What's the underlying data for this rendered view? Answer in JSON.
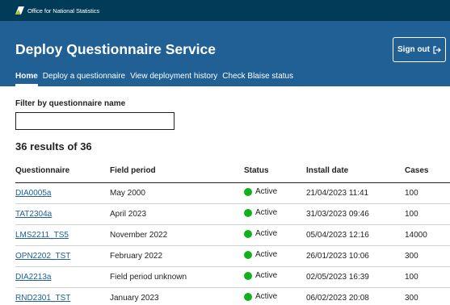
{
  "header": {
    "org_name": "Office for National Statistics",
    "org_icon": "ons-logo-icon",
    "title": "Deploy Questionnaire Service",
    "sign_out_label": "Sign out",
    "sign_out_icon": "sign-out-icon"
  },
  "nav": {
    "items": [
      {
        "label": "Home",
        "active": true
      },
      {
        "label": "Deploy a questionnaire",
        "active": false
      },
      {
        "label": "View deployment history",
        "active": false
      },
      {
        "label": "Check Blaise status",
        "active": false
      }
    ]
  },
  "filter": {
    "label": "Filter by questionnaire name",
    "value": ""
  },
  "results_summary": "36 results of 36",
  "table": {
    "columns": [
      "Questionnaire",
      "Field period",
      "Status",
      "Install date",
      "Cases"
    ],
    "rows": [
      {
        "questionnaire": "DIA0005a",
        "field_period": "May 2000",
        "status": "Active",
        "install_date": "21/04/2023 11:41",
        "cases": "100"
      },
      {
        "questionnaire": "TAT2304a",
        "field_period": "April 2023",
        "status": "Active",
        "install_date": "31/03/2023 09:46",
        "cases": "100"
      },
      {
        "questionnaire": "LMS2211_TS5",
        "field_period": "November 2022",
        "status": "Active",
        "install_date": "05/04/2023 12:16",
        "cases": "14000"
      },
      {
        "questionnaire": "OPN2202_TST",
        "field_period": "February 2022",
        "status": "Active",
        "install_date": "26/01/2023 10:06",
        "cases": "300"
      },
      {
        "questionnaire": "DIA2213a",
        "field_period": "Field period unknown",
        "status": "Active",
        "install_date": "02/05/2023 16:39",
        "cases": "100"
      },
      {
        "questionnaire": "RND2301_TST",
        "field_period": "January 2023",
        "status": "Active",
        "install_date": "06/02/2023 20:08",
        "cases": "300"
      }
    ]
  },
  "colors": {
    "topbar": "#003c57",
    "banner": "#206095",
    "link": "#206095",
    "status_active": "#10b11a"
  }
}
